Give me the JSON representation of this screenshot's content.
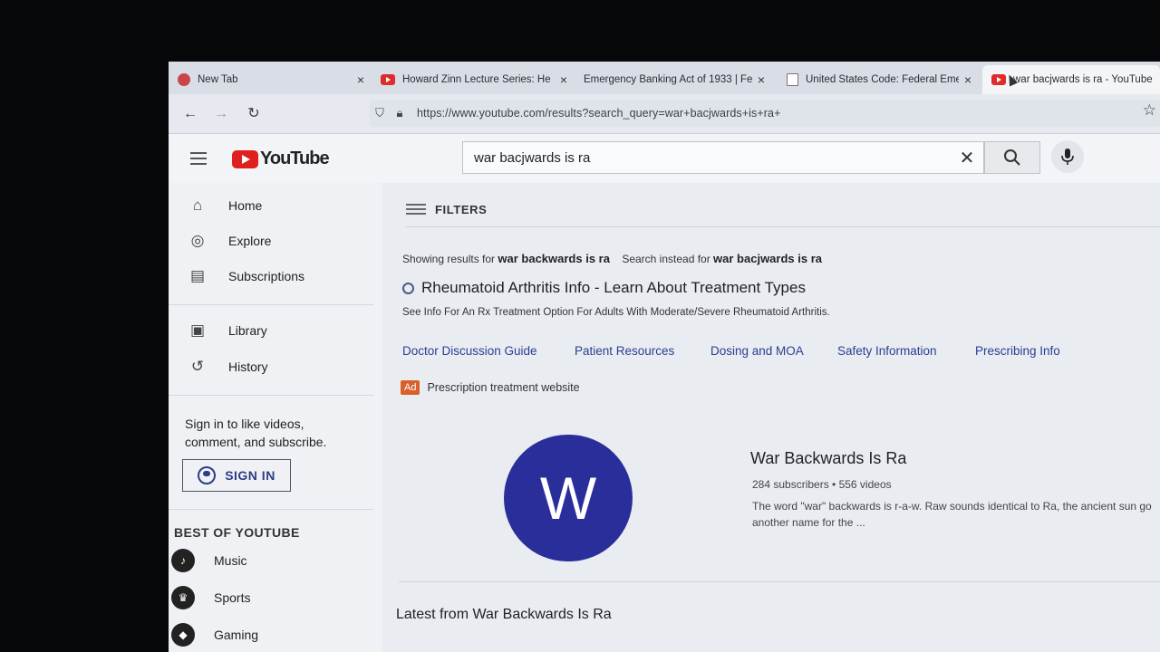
{
  "browser": {
    "tabs": [
      {
        "title": "New Tab",
        "icon": "red-circle-icon"
      },
      {
        "title": "Howard Zinn Lecture Series: He",
        "icon": "youtube-icon"
      },
      {
        "title": "Emergency Banking Act of 1933 | Fe",
        "icon": "none"
      },
      {
        "title": "United States Code: Federal Eme",
        "icon": "document-icon"
      },
      {
        "title": "war bacjwards is ra - YouTube",
        "icon": "youtube-icon",
        "active": true
      }
    ],
    "close_glyph": "×",
    "url": "https://www.youtube.com/results?search_query=war+bacjwards+is+ra+"
  },
  "masthead": {
    "logo_text": "YouTube",
    "search_value": "war bacjwards is ra",
    "clear_glyph": "✕"
  },
  "sidebar": {
    "primary": [
      {
        "label": "Home",
        "icon": "home-icon"
      },
      {
        "label": "Explore",
        "icon": "compass-icon"
      },
      {
        "label": "Subscriptions",
        "icon": "subscriptions-icon"
      }
    ],
    "secondary": [
      {
        "label": "Library",
        "icon": "library-icon"
      },
      {
        "label": "History",
        "icon": "history-icon"
      }
    ],
    "signin_prompt": "Sign in to like videos, comment, and subscribe.",
    "signin_button": "SIGN IN",
    "best_of_title": "BEST OF YOUTUBE",
    "best_of": [
      {
        "label": "Music",
        "icon": "music-icon"
      },
      {
        "label": "Sports",
        "icon": "trophy-icon"
      },
      {
        "label": "Gaming",
        "icon": "gamepad-icon"
      }
    ]
  },
  "results": {
    "filters_label": "FILTERS",
    "showing_prefix": "Showing results for",
    "showing_query": "war backwards is ra",
    "instead_prefix": "Search instead for",
    "instead_query": "war bacjwards is ra",
    "ad": {
      "title": "Rheumatoid Arthritis Info - Learn About Treatment Types",
      "description": "See Info For An Rx Treatment Option For Adults With Moderate/Severe Rheumatoid Arthritis.",
      "links": [
        "Doctor Discussion Guide",
        "Patient Resources",
        "Dosing and MOA",
        "Safety Information",
        "Prescribing Info"
      ],
      "badge": "Ad",
      "label": "Prescription treatment website"
    },
    "channel": {
      "avatar_letter": "W",
      "avatar_color": "#2a2e9a",
      "name": "War Backwards Is Ra",
      "stats": "284 subscribers • 556 videos",
      "description": "The word \"war\" backwards is r-a-w. Raw sounds identical to Ra, the ancient sun go another name for the ..."
    },
    "latest_heading": "Latest from War Backwards Is Ra"
  },
  "colors": {
    "youtube_red": "#e0201e",
    "link_blue": "#2a3f92",
    "ad_badge": "#d9602a"
  }
}
